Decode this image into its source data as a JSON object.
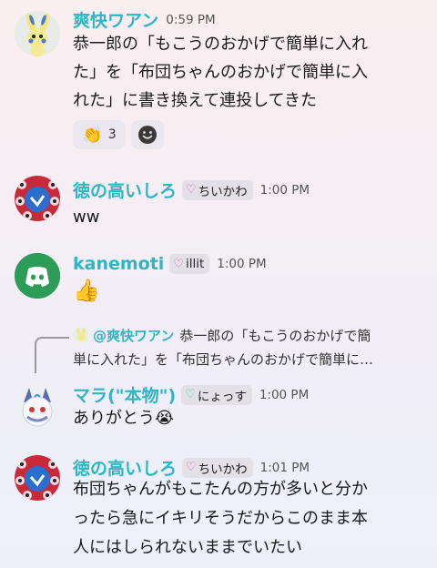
{
  "messages": [
    {
      "author": "爽快ワアン",
      "author_color": "#2fb6c4",
      "time": "0:59 PM",
      "lines": [
        "恭一郎の「もこうのおかげで簡単に入れ",
        "た」を「布団ちゃんのおかげで簡単に入",
        "れた」に書き換えて連投してきた"
      ],
      "reaction": {
        "emoji": "👏",
        "count": "3"
      },
      "add_reaction_icon": "smiley-icon"
    },
    {
      "author": "徳の高いしろ",
      "author_color": "#2fb6c4",
      "badge": "ちいかわ",
      "badge_heart_color": "#e05aa8",
      "time": "1:00 PM",
      "lines": [
        "ww"
      ]
    },
    {
      "author": "kanemoti",
      "author_color": "#2fb6c4",
      "badge": "illit",
      "badge_heart_color": "#e05aa8",
      "time": "1:00 PM",
      "emoji": "👍"
    },
    {
      "reply_to": {
        "author": "@爽快ワアン",
        "lines": [
          "恭一郎の「もこうのおかげで簡",
          "単に入れた」を「布団ちゃんのおかげで簡単に…"
        ]
      },
      "author": "マラ(\"本物\")",
      "author_color": "#2fb6c4",
      "badge": "にょっす",
      "badge_heart_color": "#35c9b0",
      "time": "1:00 PM",
      "lines": [
        "ありがとう😭"
      ]
    },
    {
      "author": "徳の高いしろ",
      "author_color": "#2fb6c4",
      "badge": "ちいかわ",
      "badge_heart_color": "#e05aa8",
      "time": "1:01 PM",
      "lines": [
        "布団ちゃんがもこたんの方が多いと分か",
        "ったら急にイキリそうだからこのまま本",
        "人にはしられないままでいたい"
      ]
    }
  ]
}
